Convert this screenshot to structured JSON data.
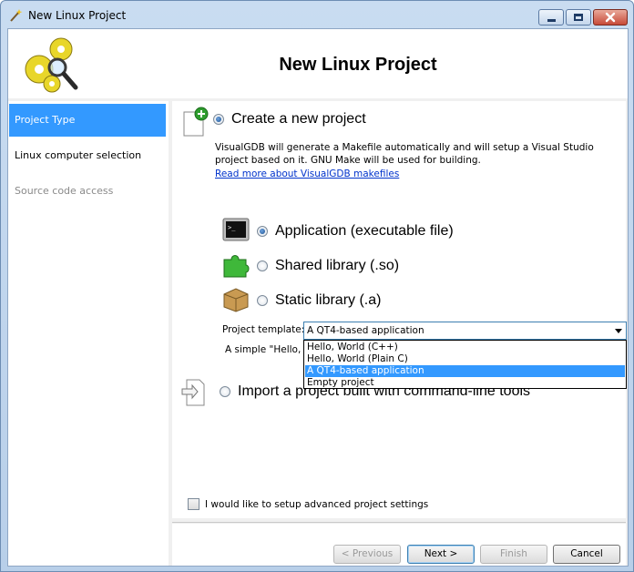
{
  "window": {
    "title": "New Linux Project"
  },
  "header": {
    "heading": "New Linux Project"
  },
  "sidebar": {
    "items": [
      {
        "label": "Project Type"
      },
      {
        "label": "Linux computer selection"
      },
      {
        "label": "Source code access"
      }
    ]
  },
  "main": {
    "create_label": "Create a new project",
    "description": "VisualGDB will generate a Makefile automatically and will setup a Visual Studio project based on it. GNU Make will be used for building.",
    "link": "Read more about VisualGDB makefiles",
    "types": [
      {
        "label": "Application (executable file)"
      },
      {
        "label": "Shared library (.so)"
      },
      {
        "label": "Static library (.a)"
      }
    ],
    "template_label": "Project template:",
    "template_value": "A QT4-based application",
    "template_options": [
      "Hello, World (C++)",
      "Hello, World (Plain C)",
      "A QT4-based application",
      "Empty project"
    ],
    "template_desc": "A simple \"Hello, W",
    "import_label": "Import a project built with command-line tools",
    "advanced_label": "I would like to setup advanced project settings"
  },
  "buttons": {
    "previous": "< Previous",
    "next": "Next >",
    "finish": "Finish",
    "cancel": "Cancel"
  },
  "colors": {
    "selection": "#3399ff",
    "link": "#0033cc"
  }
}
